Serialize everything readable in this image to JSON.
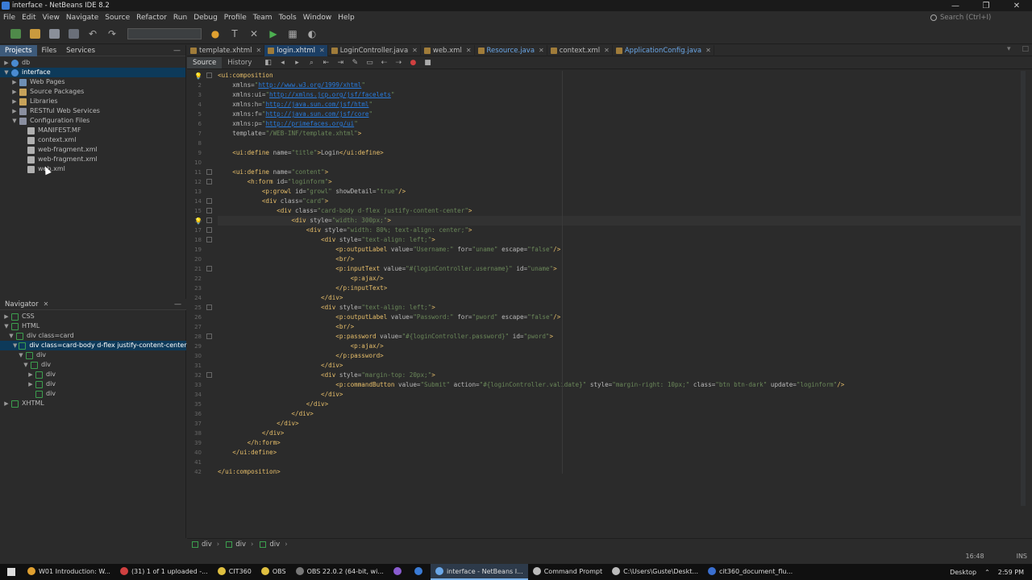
{
  "window": {
    "title": "interface - NetBeans IDE 8.2",
    "controls": [
      "—",
      "❐",
      "✕"
    ]
  },
  "menu": {
    "items": [
      "File",
      "Edit",
      "View",
      "Navigate",
      "Source",
      "Refactor",
      "Run",
      "Debug",
      "Profile",
      "Team",
      "Tools",
      "Window",
      "Help"
    ],
    "search_placeholder": "Search (Ctrl+I)"
  },
  "projects_panel": {
    "tabs": [
      "Projects",
      "Files",
      "Services"
    ],
    "tree": [
      {
        "label": "db",
        "indent": 0,
        "toggle": "▶",
        "icon": "globe-icon",
        "color": "#4a8bd1"
      },
      {
        "label": "interface",
        "indent": 0,
        "toggle": "▼",
        "icon": "globe-icon",
        "color": "#4a8bd1",
        "selected": true
      },
      {
        "label": "Web Pages",
        "indent": 1,
        "toggle": "▶",
        "icon": "folder-icon",
        "color": "#6e8fb5"
      },
      {
        "label": "Source Packages",
        "indent": 1,
        "toggle": "▶",
        "icon": "package-icon",
        "color": "#c7a25a"
      },
      {
        "label": "Libraries",
        "indent": 1,
        "toggle": "▶",
        "icon": "library-icon",
        "color": "#c7a25a"
      },
      {
        "label": "RESTful Web Services",
        "indent": 1,
        "toggle": "▶",
        "icon": "service-icon",
        "color": "#8a8fa0"
      },
      {
        "label": "Configuration Files",
        "indent": 1,
        "toggle": "▼",
        "icon": "config-folder-icon",
        "color": "#8a8fa0"
      },
      {
        "label": "MANIFEST.MF",
        "indent": 2,
        "toggle": "",
        "icon": "file-icon",
        "color": "#b0b0b0"
      },
      {
        "label": "context.xml",
        "indent": 2,
        "toggle": "",
        "icon": "xml-file-icon",
        "color": "#b0b0b0"
      },
      {
        "label": "web-fragment.xml",
        "indent": 2,
        "toggle": "",
        "icon": "xml-file-icon",
        "color": "#b0b0b0"
      },
      {
        "label": "web-fragment.xml",
        "indent": 2,
        "toggle": "",
        "icon": "xml-file-icon",
        "color": "#b0b0b0"
      },
      {
        "label": "web.xml",
        "indent": 2,
        "toggle": "",
        "icon": "xml-file-icon",
        "color": "#b0b0b0"
      }
    ]
  },
  "navigator": {
    "title": "Navigator",
    "tree": [
      {
        "label": "CSS",
        "indent": 0,
        "toggle": "▶"
      },
      {
        "label": "HTML",
        "indent": 0,
        "toggle": "▼"
      },
      {
        "label": "div class=card",
        "indent": 1,
        "toggle": "▼"
      },
      {
        "label": "div class=card-body d-flex justify-content-center",
        "indent": 2,
        "toggle": "▼",
        "selected": true
      },
      {
        "label": "div",
        "indent": 3,
        "toggle": "▼"
      },
      {
        "label": "div",
        "indent": 4,
        "toggle": "▼"
      },
      {
        "label": "div",
        "indent": 5,
        "toggle": "▶"
      },
      {
        "label": "div",
        "indent": 5,
        "toggle": "▶"
      },
      {
        "label": "div",
        "indent": 5,
        "toggle": ""
      },
      {
        "label": "XHTML",
        "indent": 0,
        "toggle": "▶"
      }
    ]
  },
  "editor": {
    "tabs": [
      {
        "label": "template.xhtml",
        "active": false,
        "blue": false
      },
      {
        "label": "login.xhtml",
        "active": true,
        "blue": false
      },
      {
        "label": "LoginController.java",
        "active": false,
        "blue": false
      },
      {
        "label": "web.xml",
        "active": false,
        "blue": false
      },
      {
        "label": "Resource.java",
        "active": false,
        "blue": true
      },
      {
        "label": "context.xml",
        "active": false,
        "blue": false
      },
      {
        "label": "ApplicationConfig.java",
        "active": false,
        "blue": true
      }
    ],
    "source_tab": "Source",
    "history_tab": "History",
    "current_line": 16,
    "lines": [
      "<ui:composition",
      "    xmlns=\"http://www.w3.org/1999/xhtml\"",
      "    xmlns:ui=\"http://xmlns.jcp.org/jsf/facelets\"",
      "    xmlns:h=\"http://java.sun.com/jsf/html\"",
      "    xmlns:f=\"http://java.sun.com/jsf/core\"",
      "    xmlns:p=\"http://primefaces.org/ui\"",
      "    template=\"/WEB-INF/template.xhtml\">",
      "",
      "    <ui:define name=\"title\">Login</ui:define>",
      "",
      "    <ui:define name=\"content\">",
      "        <h:form id=\"loginform\">",
      "            <p:growl id=\"growl\" showDetail=\"true\"/>",
      "            <div class=\"card\">",
      "                <div class=\"card-body d-flex justify-content-center\">",
      "                    <div style=\"width: 300px;\">",
      "                        <div style=\"width: 80%; text-align: center;\">",
      "                            <div style=\"text-align: left;\">",
      "                                <p:outputLabel value=\"Username:\" for=\"uname\" escape=\"false\"/>",
      "                                <br/>",
      "                                <p:inputText value=\"#{loginController.username}\" id=\"uname\">",
      "                                    <p:ajax/>",
      "                                </p:inputText>",
      "                            </div>",
      "                            <div style=\"text-align: left;\">",
      "                                <p:outputLabel value=\"Password:\" for=\"pword\" escape=\"false\"/>",
      "                                <br/>",
      "                                <p:password value=\"#{loginController.password}\" id=\"pword\">",
      "                                    <p:ajax/>",
      "                                </p:password>",
      "                            </div>",
      "                            <div style=\"margin-top: 20px;\">",
      "                                <p:commandButton value=\"Submit\" action=\"#{loginController.validate}\" style=\"margin-right: 10px;\" class=\"btn btn-dark\" update=\"loginform\"/>",
      "                            </div>",
      "                        </div>",
      "                    </div>",
      "                </div>",
      "            </div>",
      "        </h:form>",
      "    </ui:define>",
      "",
      "</ui:composition>"
    ],
    "breadcrumbs": [
      "div",
      "div",
      "div"
    ]
  },
  "status": {
    "position": "16:48",
    "mode": "INS"
  },
  "taskbar": {
    "items": [
      {
        "label": "W01 Introduction: W...",
        "color": "#e0a030"
      },
      {
        "label": "(31) 1 of 1 uploaded -...",
        "color": "#d04040"
      },
      {
        "label": "CIT360",
        "color": "#e0c040"
      },
      {
        "label": "OBS",
        "color": "#e0c040"
      },
      {
        "label": "OBS 22.0.2 (64-bit, wi...",
        "color": "#777777"
      },
      {
        "label": "",
        "color": "#8a5cd0"
      },
      {
        "label": "",
        "color": "#3a7bd5"
      },
      {
        "label": "interface - NetBeans I...",
        "color": "#6aa7e8",
        "active": true
      },
      {
        "label": "Command Prompt",
        "color": "#bbbbbb"
      },
      {
        "label": "C:\\Users\\Guste\\Deskt...",
        "color": "#bbbbbb"
      },
      {
        "label": "cit360_document_flu...",
        "color": "#3a6fd0"
      }
    ],
    "desktop_label": "Desktop",
    "time": "2:59 PM"
  }
}
